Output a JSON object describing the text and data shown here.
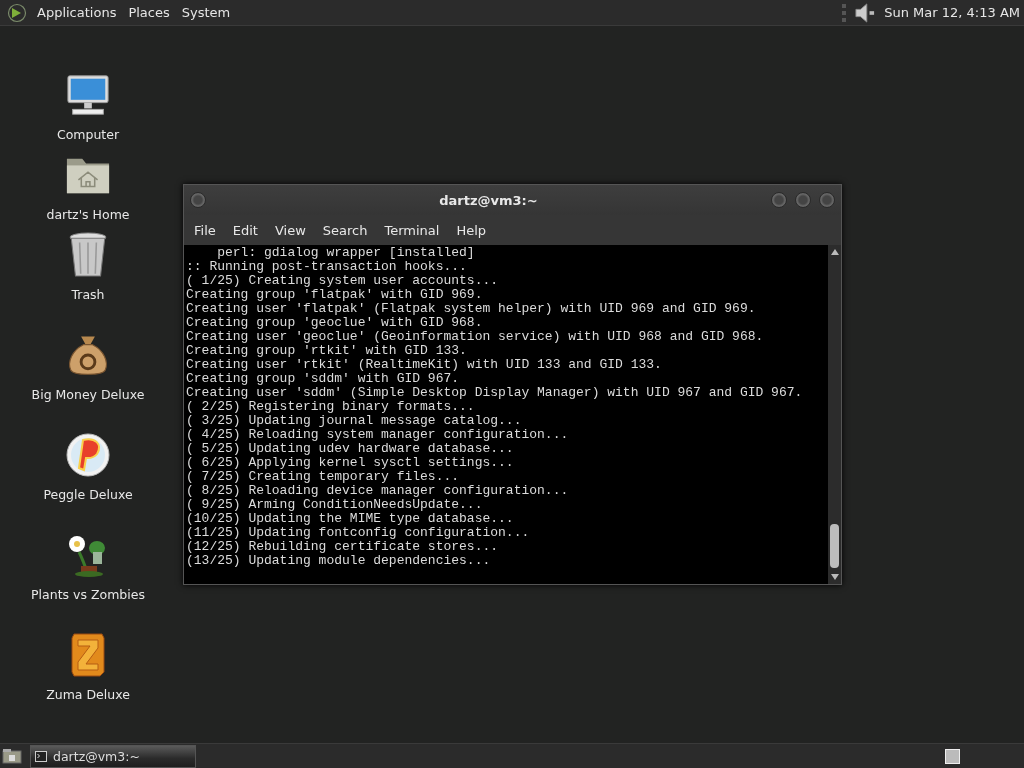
{
  "top_panel": {
    "menus": [
      "Applications",
      "Places",
      "System"
    ],
    "clock": "Sun Mar 12,  4:13 AM"
  },
  "desktop_icons": [
    {
      "label": "Computer",
      "kind": "computer"
    },
    {
      "label": "dartz's Home",
      "kind": "home"
    },
    {
      "label": "Trash",
      "kind": "trash"
    },
    {
      "label": "Big Money Deluxe",
      "kind": "moneybag"
    },
    {
      "label": "Peggle Deluxe",
      "kind": "ball"
    },
    {
      "label": "Plants vs Zombies",
      "kind": "plant"
    },
    {
      "label": "Zuma Deluxe",
      "kind": "block"
    }
  ],
  "terminal": {
    "title": "dartz@vm3:~",
    "menu": [
      "File",
      "Edit",
      "View",
      "Search",
      "Terminal",
      "Help"
    ],
    "lines": [
      "    perl: gdialog wrapper [installed]",
      ":: Running post-transaction hooks...",
      "( 1/25) Creating system user accounts...",
      "Creating group 'flatpak' with GID 969.",
      "Creating user 'flatpak' (Flatpak system helper) with UID 969 and GID 969.",
      "Creating group 'geoclue' with GID 968.",
      "Creating user 'geoclue' (Geoinformation service) with UID 968 and GID 968.",
      "Creating group 'rtkit' with GID 133.",
      "Creating user 'rtkit' (RealtimeKit) with UID 133 and GID 133.",
      "Creating group 'sddm' with GID 967.",
      "Creating user 'sddm' (Simple Desktop Display Manager) with UID 967 and GID 967.",
      "( 2/25) Registering binary formats...",
      "( 3/25) Updating journal message catalog...",
      "( 4/25) Reloading system manager configuration...",
      "( 5/25) Updating udev hardware database...",
      "( 6/25) Applying kernel sysctl settings...",
      "( 7/25) Creating temporary files...",
      "( 8/25) Reloading device manager configuration...",
      "( 9/25) Arming ConditionNeedsUpdate...",
      "(10/25) Updating the MIME type database...",
      "(11/25) Updating fontconfig configuration...",
      "(12/25) Rebuilding certificate stores...",
      "(13/25) Updating module dependencies..."
    ]
  },
  "taskbar": {
    "tasks": [
      {
        "label": "dartz@vm3:~",
        "selected": true
      }
    ]
  }
}
